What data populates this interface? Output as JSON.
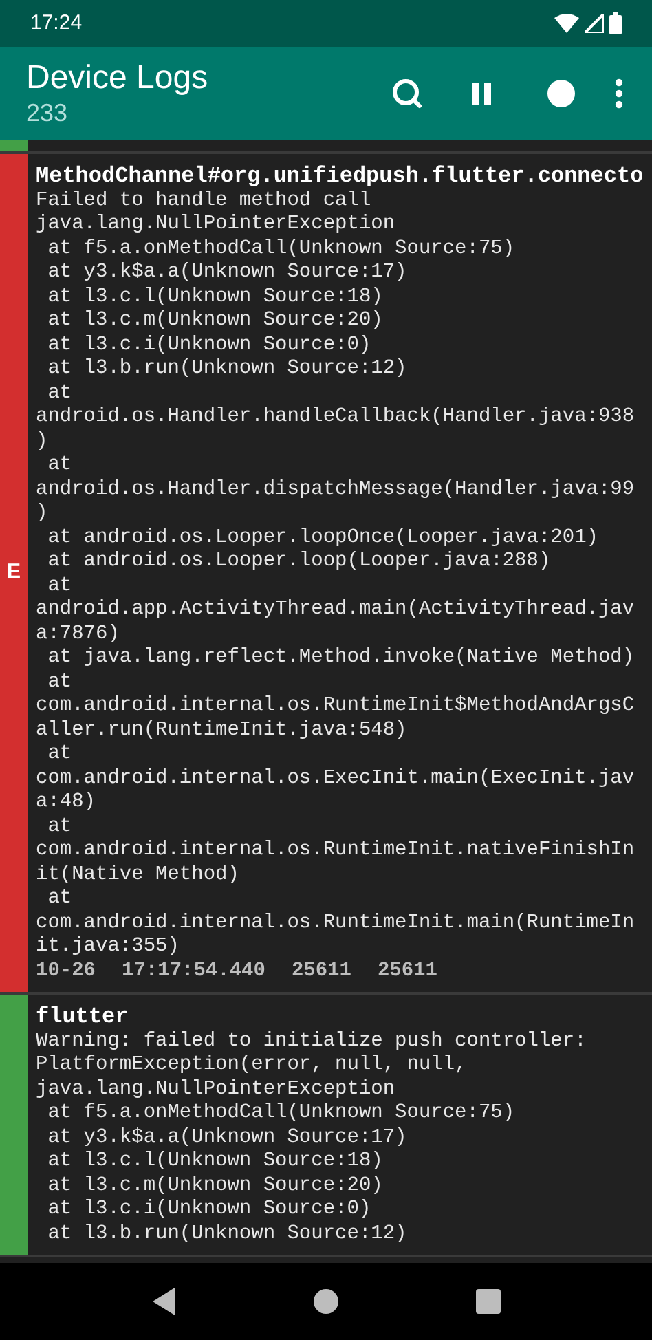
{
  "status_bar": {
    "time": "17:24"
  },
  "app_bar": {
    "title": "Device Logs",
    "subtitle": "233"
  },
  "entries": [
    {
      "color": "#43a047"
    },
    {
      "color": "#d32f2f",
      "level_letter": "E",
      "tag": "MethodChannel#org.unifiedpush.flutter.connecto",
      "lines": [
        "Failed to handle method call",
        "java.lang.NullPointerException",
        " at f5.a.onMethodCall(Unknown Source:75)",
        " at y3.k$a.a(Unknown Source:17)",
        " at l3.c.l(Unknown Source:18)",
        " at l3.c.m(Unknown Source:20)",
        " at l3.c.i(Unknown Source:0)",
        " at l3.b.run(Unknown Source:12)",
        " at",
        "android.os.Handler.handleCallback(Handler.java:938",
        ")",
        " at",
        "android.os.Handler.dispatchMessage(Handler.java:99",
        ")",
        " at android.os.Looper.loopOnce(Looper.java:201)",
        " at android.os.Looper.loop(Looper.java:288)",
        " at",
        "android.app.ActivityThread.main(ActivityThread.jav",
        "a:7876)",
        " at java.lang.reflect.Method.invoke(Native Method)",
        " at",
        "com.android.internal.os.RuntimeInit$MethodAndArgsC",
        "aller.run(RuntimeInit.java:548)",
        " at",
        "com.android.internal.os.ExecInit.main(ExecInit.jav",
        "a:48)",
        " at",
        "com.android.internal.os.RuntimeInit.nativeFinishIn",
        "it(Native Method)",
        " at",
        "com.android.internal.os.RuntimeInit.main(RuntimeIn",
        "it.java:355)"
      ],
      "meta": [
        "10-26",
        "17:17:54.440",
        "25611",
        "25611"
      ]
    },
    {
      "color": "#43a047",
      "tag": "flutter",
      "lines": [
        "Warning: failed to initialize push controller:",
        "PlatformException(error, null, null,",
        "java.lang.NullPointerException",
        " at f5.a.onMethodCall(Unknown Source:75)",
        " at y3.k$a.a(Unknown Source:17)",
        " at l3.c.l(Unknown Source:18)",
        " at l3.c.m(Unknown Source:20)",
        " at l3.c.i(Unknown Source:0)",
        " at l3.b.run(Unknown Source:12)"
      ]
    }
  ]
}
